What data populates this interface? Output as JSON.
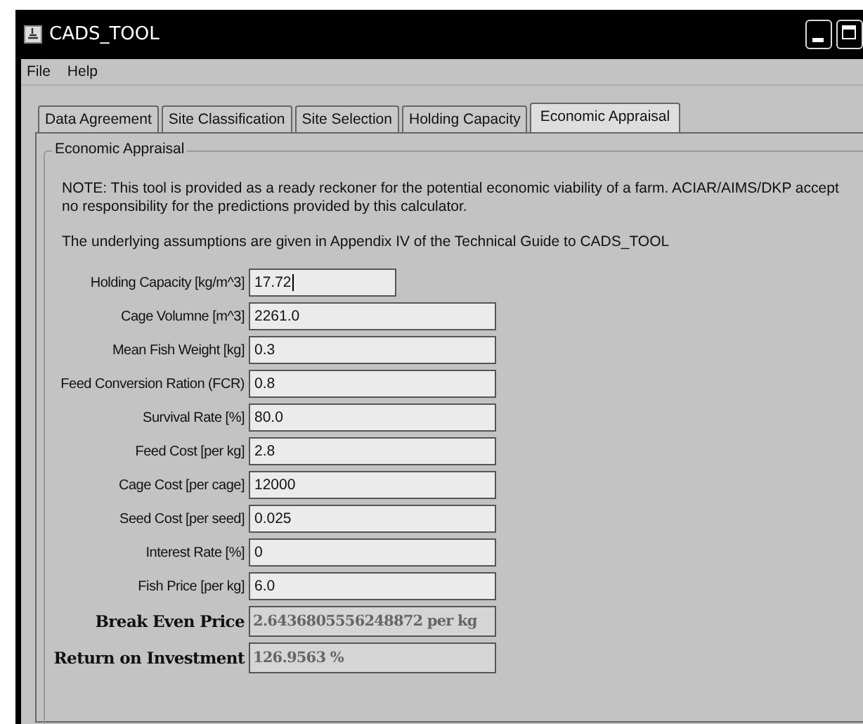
{
  "window": {
    "title": "CADS_TOOL"
  },
  "menu": [
    "File",
    "Help"
  ],
  "tabs": [
    {
      "label": "Data Agreement",
      "selected": false
    },
    {
      "label": "Site Classification",
      "selected": false
    },
    {
      "label": "Site Selection",
      "selected": false
    },
    {
      "label": "Holding Capacity",
      "selected": false
    },
    {
      "label": "Economic Appraisal",
      "selected": true
    }
  ],
  "group": {
    "title": "Economic Appraisal",
    "notes": [
      "NOTE: This tool is provided as a ready reckoner for the potential economic viability of a farm. ACIAR/AIMS/DKP accept no responsibility for the predictions provided by this calculator.",
      "The underlying assumptions are given in Appendix IV of the Technical Guide to CADS_TOOL"
    ],
    "fields": [
      {
        "kind": "input",
        "label": "Holding Capacity [kg/m^3]",
        "value": "17.72",
        "focused": true
      },
      {
        "kind": "input",
        "label": "Cage Volumne [m^3]",
        "value": "2261.0",
        "focused": false
      },
      {
        "kind": "input",
        "label": "Mean Fish Weight [kg]",
        "value": "0.3",
        "focused": false
      },
      {
        "kind": "input",
        "label": "Feed Conversion Ration (FCR)",
        "value": "0.8",
        "focused": false
      },
      {
        "kind": "input",
        "label": "Survival Rate [%]",
        "value": "80.0",
        "focused": false
      },
      {
        "kind": "input",
        "label": "Feed Cost [per kg]",
        "value": "2.8",
        "focused": false
      },
      {
        "kind": "input",
        "label": "Cage Cost [per cage]",
        "value": "12000",
        "focused": false
      },
      {
        "kind": "input",
        "label": "Seed Cost [per seed]",
        "value": "0.025",
        "focused": false
      },
      {
        "kind": "input",
        "label": "Interest Rate [%]",
        "value": "0",
        "focused": false
      },
      {
        "kind": "input",
        "label": "Fish Price [per kg]",
        "value": "6.0",
        "focused": false
      },
      {
        "kind": "result",
        "label": "Break Even Price",
        "value": "2.6436805556248872 per kg",
        "focused": false
      },
      {
        "kind": "result",
        "label": "Return on Investment",
        "value": "126.9563 %",
        "focused": false
      }
    ]
  }
}
